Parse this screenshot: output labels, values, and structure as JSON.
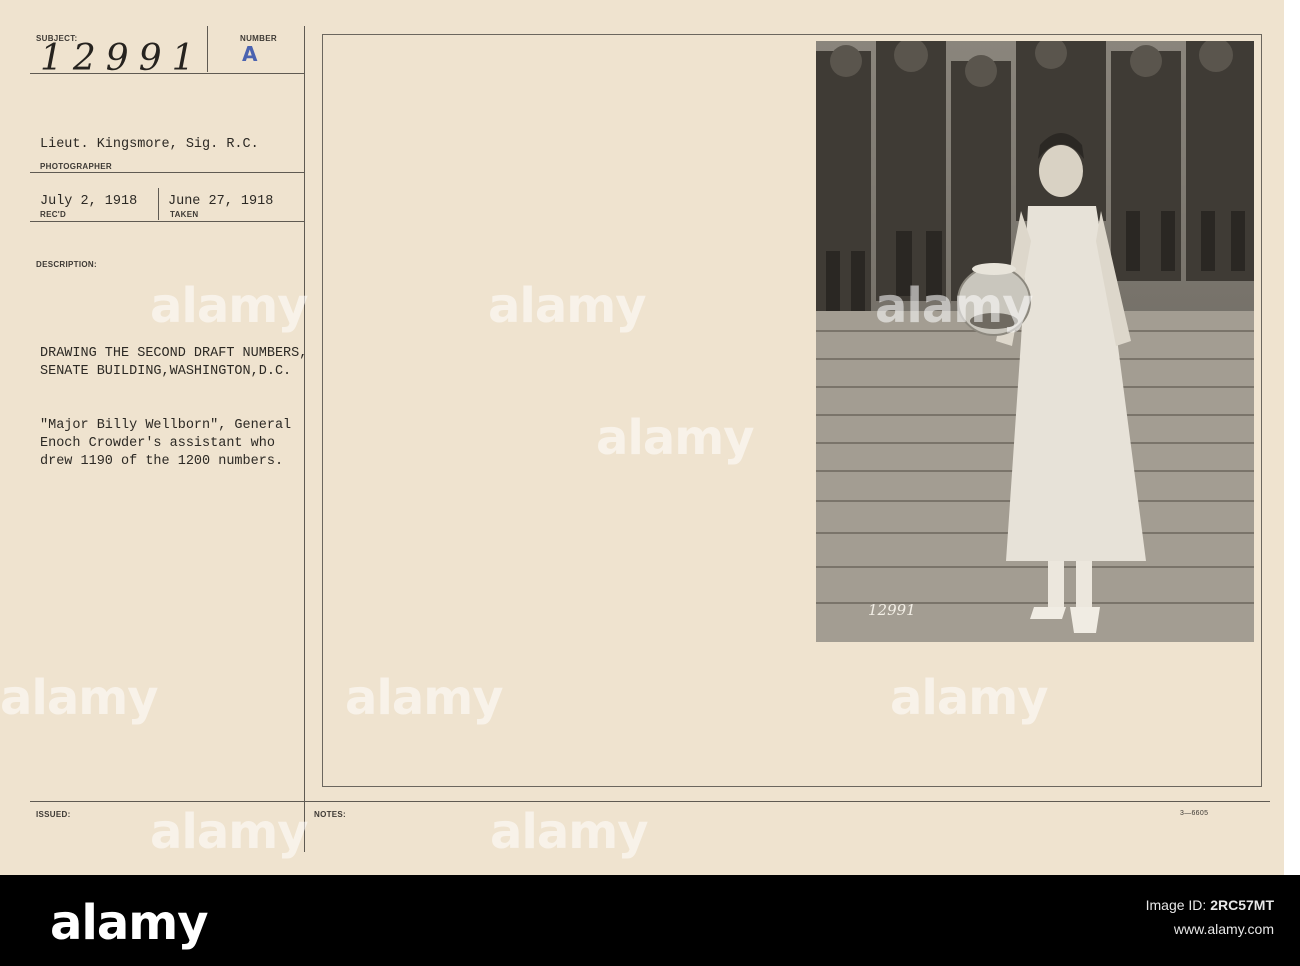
{
  "card": {
    "subject_label": "SUBJECT:",
    "subject_value": "12991",
    "number_label": "NUMBER",
    "number_value": "A",
    "photographer_value": "Lieut. Kingsmore, Sig. R.C.",
    "photographer_label": "PHOTOGRAPHER",
    "received_value": "July 2, 1918",
    "received_label": "REC'D",
    "taken_value": "June 27, 1918",
    "taken_label": "TAKEN",
    "description_label": "DESCRIPTION:",
    "description_lines": [
      "DRAWING THE SECOND DRAFT NUMBERS,",
      "SENATE BUILDING,WASHINGTON,D.C.",
      "",
      "\"Major Billy Wellborn\", General",
      "Enoch Crowder's assistant who",
      "drew 1190 of the 1200 numbers."
    ],
    "issued_label": "ISSUED:",
    "notes_label": "NOTES:",
    "form_code": "3—6605",
    "photo_number": "12991"
  },
  "watermarks": [
    "alamy",
    "alamy",
    "alamy",
    "alamy",
    "alamy",
    "alamy",
    "alamy",
    "alamy",
    "alamy"
  ],
  "footer": {
    "logo": "alamy",
    "image_id_label": "Image ID:",
    "image_id": "2RC57MT",
    "url": "www.alamy.com"
  }
}
